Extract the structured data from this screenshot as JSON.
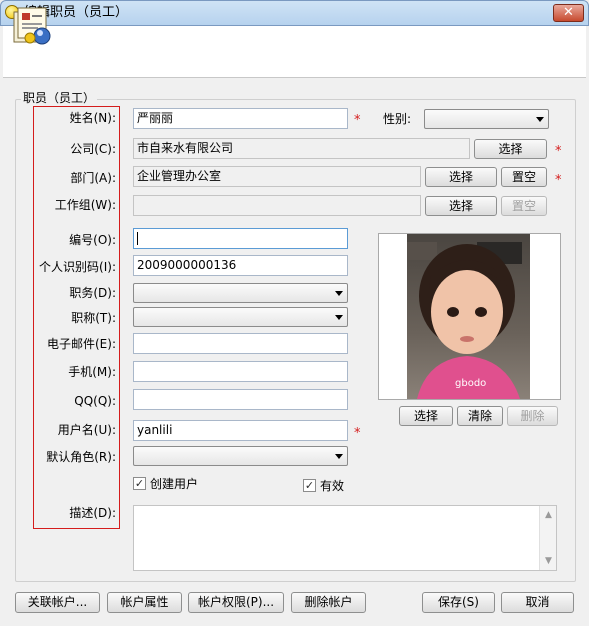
{
  "window": {
    "title": "编辑职员（员工）",
    "close_glyph": "✕"
  },
  "group": {
    "label": "职员（员工）"
  },
  "fields": {
    "name_label": "姓名(N):",
    "name_value": "严丽丽",
    "gender_label": "性别:",
    "gender_value": "",
    "company_label": "公司(C):",
    "company_value": "市自来水有限公司",
    "dept_label": "部门(A):",
    "dept_value": "企业管理办公室",
    "workgroup_label": "工作组(W):",
    "workgroup_value": "",
    "code_label": "编号(O):",
    "code_value": "",
    "id_label": "个人识别码(I):",
    "id_value": "2009000000136",
    "position_label": "职务(D):",
    "position_value": "",
    "title_label": "职称(T):",
    "title_value": "",
    "email_label": "电子邮件(E):",
    "email_value": "",
    "mobile_label": "手机(M):",
    "mobile_value": "",
    "qq_label": "QQ(Q):",
    "qq_value": "",
    "username_label": "用户名(U):",
    "username_value": "yanlili",
    "role_label": "默认角色(R):",
    "role_value": "",
    "desc_label": "描述(D):",
    "desc_value": ""
  },
  "required_mark": "*",
  "buttons": {
    "select": "选择",
    "clear_dept": "置空",
    "photo_select": "选择",
    "photo_clear": "清除",
    "photo_delete": "删除",
    "link_account": "关联帐户...",
    "account_props": "帐户属性",
    "account_perms": "帐户权限(P)...",
    "delete_account": "删除帐户",
    "save": "保存(S)",
    "cancel": "取消"
  },
  "checkboxes": {
    "create_user_label": "创建用户",
    "create_user_checked": true,
    "active_label": "有效",
    "active_checked": true,
    "check_glyph": "✓"
  },
  "colors": {
    "required": "#d41c1c",
    "accent": "#5b9bd5"
  }
}
